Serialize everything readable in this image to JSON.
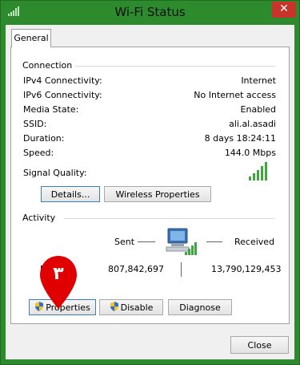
{
  "window": {
    "title": "Wi-Fi Status",
    "close_glyph": "✕"
  },
  "tabs": [
    {
      "label": "General"
    }
  ],
  "connection": {
    "heading": "Connection",
    "rows": [
      {
        "label": "IPv4 Connectivity:",
        "value": "Internet"
      },
      {
        "label": "IPv6 Connectivity:",
        "value": "No Internet access"
      },
      {
        "label": "Media State:",
        "value": "Enabled"
      },
      {
        "label": "SSID:",
        "value": "ali.al.asadi"
      },
      {
        "label": "Duration:",
        "value": "8 days 18:24:11"
      },
      {
        "label": "Speed:",
        "value": "144.0 Mbps"
      }
    ],
    "signal_label": "Signal Quality:",
    "signal_bars": 5,
    "details_button": "Details...",
    "wireless_button": "Wireless Properties"
  },
  "activity": {
    "heading": "Activity",
    "sent_label": "Sent",
    "received_label": "Received",
    "bytes_label_partial": "B",
    "sent_value": "807,842,697",
    "received_value": "13,790,129,453"
  },
  "buttons": {
    "properties": "Properties",
    "disable": "Disable",
    "diagnose": "Diagnose",
    "close": "Close"
  },
  "marker": {
    "text": "٣",
    "color": "#e00000"
  },
  "colors": {
    "title_bar": "#2d8a2d",
    "signal": "#3fa63f",
    "close_button": "#c7342a"
  },
  "icons": {
    "app": "wifi-signal-icon",
    "signal": "signal-strength-icon",
    "computer": "network-computer-icon",
    "shield": "uac-shield-icon"
  }
}
